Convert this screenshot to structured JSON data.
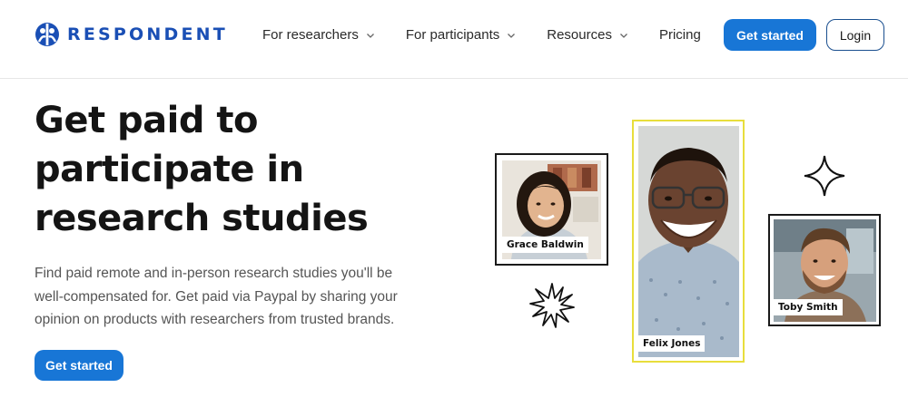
{
  "brand": {
    "name": "RESPONDENT",
    "accent": "#1876d6",
    "logo_color": "#1a4fb5"
  },
  "nav": {
    "items": [
      {
        "label": "For researchers",
        "has_dropdown": true
      },
      {
        "label": "For participants",
        "has_dropdown": true
      },
      {
        "label": "Resources",
        "has_dropdown": true
      },
      {
        "label": "Pricing",
        "has_dropdown": false
      }
    ]
  },
  "header_actions": {
    "get_started": "Get started",
    "login": "Login"
  },
  "hero": {
    "title_lines": [
      "Get paid to",
      "participate in",
      "research studies"
    ],
    "description": "Find paid remote and in-person research studies you'll be well-compensated for. Get paid via Paypal by sharing your opinion on products with researchers from trusted brands.",
    "cta": "Get started"
  },
  "participants": [
    {
      "name": "Grace Baldwin"
    },
    {
      "name": "Felix Jones"
    },
    {
      "name": "Toby Smith"
    }
  ],
  "icons": [
    "respondent-logo-icon",
    "chevron-down-icon",
    "four-point-star-icon",
    "burst-star-icon"
  ]
}
